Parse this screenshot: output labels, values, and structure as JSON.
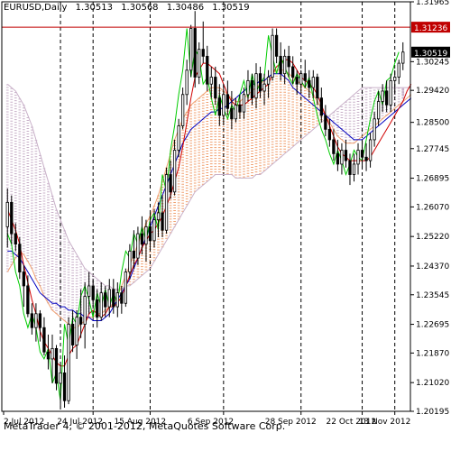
{
  "app": {
    "symbol": "EURUSD",
    "timeframe": "Daily",
    "open": "1.30513",
    "high": "1.30568",
    "low": "1.30486",
    "close": "1.30519",
    "footer": "MetaTrader 4, © 2001-2012, MetaQuotes Software Corp."
  },
  "colors": {
    "background": "#ffffff",
    "candle": "#000000",
    "level_line": "#c00000",
    "level_label_bg": "#c00000",
    "price_label_bg": "#000000",
    "tenkan": "#d00000",
    "kijun": "#0000c0",
    "chikou": "#00cc00",
    "kumo_bull": "#f0a070",
    "kumo_bear": "#c8b0c8"
  },
  "chart_data": {
    "type": "candlestick",
    "title": "EURUSD,Daily",
    "x_tick_labels": [
      "2 Jul 2012",
      "24 Jul 2012",
      "15 Aug 2012",
      "6 Sep 2012",
      "28 Sep 2012",
      "22 Oct 2012",
      "13 Nov 2012"
    ],
    "y_tick_labels": [
      "1.31965",
      "1.31236",
      "1.30519",
      "1.30245",
      "1.29420",
      "1.28500",
      "1.27745",
      "1.26895",
      "1.26070",
      "1.25220",
      "1.24370",
      "1.23545",
      "1.22695",
      "1.21870",
      "1.21020",
      "1.20195"
    ],
    "ylim": [
      1.20195,
      1.31965
    ],
    "level_line": 1.31236,
    "last_price": 1.30519,
    "period_separator_bars": [
      13,
      21,
      35,
      53,
      72,
      87,
      95
    ],
    "ohlc": [
      [
        1.255,
        1.266,
        1.249,
        1.262
      ],
      [
        1.262,
        1.264,
        1.25,
        1.253
      ],
      [
        1.253,
        1.256,
        1.248,
        1.25
      ],
      [
        1.25,
        1.252,
        1.24,
        1.242
      ],
      [
        1.242,
        1.244,
        1.232,
        1.238
      ],
      [
        1.238,
        1.241,
        1.229,
        1.23
      ],
      [
        1.23,
        1.233,
        1.224,
        1.226
      ],
      [
        1.226,
        1.233,
        1.222,
        1.23
      ],
      [
        1.23,
        1.231,
        1.222,
        1.226
      ],
      [
        1.226,
        1.229,
        1.218,
        1.219
      ],
      [
        1.219,
        1.224,
        1.214,
        1.217
      ],
      [
        1.217,
        1.224,
        1.21,
        1.22
      ],
      [
        1.22,
        1.221,
        1.208,
        1.21
      ],
      [
        1.21,
        1.216,
        1.203,
        1.213
      ],
      [
        1.213,
        1.218,
        1.203,
        1.205
      ],
      [
        1.205,
        1.229,
        1.204,
        1.227
      ],
      [
        1.227,
        1.231,
        1.219,
        1.221
      ],
      [
        1.221,
        1.231,
        1.217,
        1.229
      ],
      [
        1.229,
        1.237,
        1.223,
        1.227
      ],
      [
        1.227,
        1.239,
        1.22,
        1.235
      ],
      [
        1.235,
        1.242,
        1.23,
        1.238
      ],
      [
        1.238,
        1.24,
        1.232,
        1.234
      ],
      [
        1.234,
        1.237,
        1.226,
        1.229
      ],
      [
        1.229,
        1.239,
        1.228,
        1.236
      ],
      [
        1.236,
        1.238,
        1.229,
        1.232
      ],
      [
        1.232,
        1.24,
        1.229,
        1.237
      ],
      [
        1.237,
        1.24,
        1.23,
        1.232
      ],
      [
        1.232,
        1.239,
        1.229,
        1.236
      ],
      [
        1.236,
        1.238,
        1.23,
        1.233
      ],
      [
        1.233,
        1.243,
        1.232,
        1.242
      ],
      [
        1.242,
        1.25,
        1.24,
        1.248
      ],
      [
        1.248,
        1.254,
        1.243,
        1.246
      ],
      [
        1.246,
        1.255,
        1.244,
        1.253
      ],
      [
        1.253,
        1.258,
        1.247,
        1.25
      ],
      [
        1.25,
        1.257,
        1.245,
        1.255
      ],
      [
        1.255,
        1.259,
        1.248,
        1.251
      ],
      [
        1.251,
        1.26,
        1.249,
        1.257
      ],
      [
        1.257,
        1.262,
        1.252,
        1.259
      ],
      [
        1.259,
        1.264,
        1.252,
        1.254
      ],
      [
        1.254,
        1.272,
        1.253,
        1.27
      ],
      [
        1.27,
        1.274,
        1.263,
        1.265
      ],
      [
        1.265,
        1.28,
        1.264,
        1.277
      ],
      [
        1.277,
        1.286,
        1.275,
        1.284
      ],
      [
        1.284,
        1.295,
        1.283,
        1.293
      ],
      [
        1.293,
        1.303,
        1.29,
        1.3
      ],
      [
        1.3,
        1.313,
        1.298,
        1.312
      ],
      [
        1.312,
        1.317,
        1.295,
        1.298
      ],
      [
        1.298,
        1.308,
        1.296,
        1.306
      ],
      [
        1.306,
        1.314,
        1.302,
        1.304
      ],
      [
        1.304,
        1.307,
        1.294,
        1.296
      ],
      [
        1.296,
        1.301,
        1.292,
        1.298
      ],
      [
        1.298,
        1.301,
        1.29,
        1.292
      ],
      [
        1.292,
        1.296,
        1.284,
        1.287
      ],
      [
        1.287,
        1.296,
        1.285,
        1.293
      ],
      [
        1.293,
        1.297,
        1.287,
        1.289
      ],
      [
        1.289,
        1.294,
        1.283,
        1.286
      ],
      [
        1.286,
        1.292,
        1.285,
        1.29
      ],
      [
        1.29,
        1.293,
        1.286,
        1.288
      ],
      [
        1.288,
        1.295,
        1.286,
        1.293
      ],
      [
        1.293,
        1.3,
        1.291,
        1.297
      ],
      [
        1.297,
        1.299,
        1.29,
        1.292
      ],
      [
        1.292,
        1.302,
        1.289,
        1.299
      ],
      [
        1.299,
        1.301,
        1.292,
        1.294
      ],
      [
        1.294,
        1.299,
        1.29,
        1.296
      ],
      [
        1.296,
        1.3,
        1.292,
        1.298
      ],
      [
        1.298,
        1.312,
        1.297,
        1.31
      ],
      [
        1.31,
        1.312,
        1.302,
        1.304
      ],
      [
        1.304,
        1.308,
        1.297,
        1.299
      ],
      [
        1.299,
        1.306,
        1.296,
        1.304
      ],
      [
        1.304,
        1.307,
        1.298,
        1.301
      ],
      [
        1.301,
        1.304,
        1.296,
        1.298
      ],
      [
        1.298,
        1.3,
        1.293,
        1.296
      ],
      [
        1.296,
        1.3,
        1.294,
        1.299
      ],
      [
        1.299,
        1.303,
        1.295,
        1.297
      ],
      [
        1.297,
        1.3,
        1.292,
        1.295
      ],
      [
        1.295,
        1.3,
        1.292,
        1.298
      ],
      [
        1.298,
        1.299,
        1.29,
        1.292
      ],
      [
        1.292,
        1.295,
        1.285,
        1.287
      ],
      [
        1.287,
        1.29,
        1.281,
        1.283
      ],
      [
        1.283,
        1.286,
        1.278,
        1.28
      ],
      [
        1.28,
        1.283,
        1.274,
        1.276
      ],
      [
        1.276,
        1.28,
        1.271,
        1.273
      ],
      [
        1.273,
        1.279,
        1.27,
        1.277
      ],
      [
        1.277,
        1.28,
        1.272,
        1.274
      ],
      [
        1.274,
        1.276,
        1.267,
        1.27
      ],
      [
        1.27,
        1.276,
        1.268,
        1.273
      ],
      [
        1.273,
        1.279,
        1.27,
        1.277
      ],
      [
        1.277,
        1.28,
        1.272,
        1.275
      ],
      [
        1.275,
        1.279,
        1.271,
        1.274
      ],
      [
        1.274,
        1.282,
        1.272,
        1.28
      ],
      [
        1.28,
        1.288,
        1.278,
        1.286
      ],
      [
        1.286,
        1.294,
        1.284,
        1.291
      ],
      [
        1.291,
        1.296,
        1.288,
        1.294
      ],
      [
        1.294,
        1.297,
        1.288,
        1.29
      ],
      [
        1.29,
        1.299,
        1.288,
        1.297
      ],
      [
        1.297,
        1.3,
        1.293,
        1.298
      ],
      [
        1.298,
        1.303,
        1.296,
        1.302
      ],
      [
        1.302,
        1.308,
        1.3,
        1.3052
      ]
    ],
    "tenkan_sen": [
      1.26,
      1.257,
      1.254,
      1.25,
      1.244,
      1.239,
      1.234,
      1.23,
      1.225,
      1.222,
      1.22,
      1.218,
      1.216,
      1.215,
      1.215,
      1.218,
      1.22,
      1.221,
      1.224,
      1.227,
      1.23,
      1.231,
      1.23,
      1.229,
      1.23,
      1.232,
      1.232,
      1.233,
      1.235,
      1.238,
      1.241,
      1.244,
      1.246,
      1.249,
      1.251,
      1.253,
      1.254,
      1.256,
      1.258,
      1.261,
      1.264,
      1.268,
      1.272,
      1.278,
      1.285,
      1.292,
      1.298,
      1.3,
      1.302,
      1.302,
      1.301,
      1.3,
      1.299,
      1.296,
      1.293,
      1.291,
      1.29,
      1.29,
      1.29,
      1.291,
      1.292,
      1.293,
      1.294,
      1.295,
      1.296,
      1.299,
      1.301,
      1.302,
      1.303,
      1.303,
      1.302,
      1.3,
      1.298,
      1.297,
      1.296,
      1.295,
      1.293,
      1.29,
      1.287,
      1.284,
      1.281,
      1.278,
      1.276,
      1.275,
      1.274,
      1.274,
      1.274,
      1.274,
      1.274,
      1.275,
      1.277,
      1.279,
      1.281,
      1.283,
      1.285,
      1.287,
      1.289,
      1.291,
      1.294,
      1.296
    ],
    "kijun_sen": [
      1.248,
      1.248,
      1.247,
      1.246,
      1.244,
      1.242,
      1.24,
      1.238,
      1.236,
      1.235,
      1.234,
      1.233,
      1.233,
      1.232,
      1.232,
      1.231,
      1.231,
      1.23,
      1.23,
      1.229,
      1.229,
      1.228,
      1.228,
      1.228,
      1.229,
      1.23,
      1.232,
      1.234,
      1.236,
      1.238,
      1.24,
      1.243,
      1.246,
      1.249,
      1.252,
      1.255,
      1.258,
      1.261,
      1.264,
      1.267,
      1.27,
      1.273,
      1.276,
      1.279,
      1.281,
      1.283,
      1.284,
      1.285,
      1.286,
      1.287,
      1.288,
      1.288,
      1.289,
      1.289,
      1.29,
      1.291,
      1.292,
      1.293,
      1.294,
      1.295,
      1.296,
      1.296,
      1.297,
      1.297,
      1.298,
      1.299,
      1.299,
      1.299,
      1.298,
      1.297,
      1.295,
      1.294,
      1.293,
      1.292,
      1.291,
      1.29,
      1.289,
      1.288,
      1.287,
      1.286,
      1.285,
      1.284,
      1.283,
      1.282,
      1.281,
      1.28,
      1.28,
      1.28,
      1.281,
      1.282,
      1.283,
      1.284,
      1.285,
      1.286,
      1.287,
      1.288,
      1.289,
      1.29,
      1.291,
      1.292
    ],
    "chikou_span": [
      1.253,
      1.25,
      1.242,
      1.238,
      1.23,
      1.226,
      1.23,
      1.226,
      1.219,
      1.217,
      1.22,
      1.21,
      1.213,
      1.205,
      1.227,
      1.221,
      1.229,
      1.227,
      1.235,
      1.238,
      1.234,
      1.229,
      1.236,
      1.232,
      1.237,
      1.232,
      1.236,
      1.233,
      1.242,
      1.248,
      1.246,
      1.253,
      1.25,
      1.255,
      1.251,
      1.257,
      1.259,
      1.254,
      1.27,
      1.265,
      1.277,
      1.284,
      1.293,
      1.3,
      1.312,
      1.298,
      1.306,
      1.304,
      1.296,
      1.298,
      1.292,
      1.287,
      1.293,
      1.289,
      1.286,
      1.29,
      1.288,
      1.293,
      1.297,
      1.292,
      1.299,
      1.294,
      1.296,
      1.298,
      1.31,
      1.304,
      1.299,
      1.304,
      1.301,
      1.298,
      1.296,
      1.299,
      1.297,
      1.295,
      1.298,
      1.292,
      1.287,
      1.283,
      1.28,
      1.276,
      1.273,
      1.277,
      1.274,
      1.27,
      1.273,
      1.277,
      1.275,
      1.274,
      1.28,
      1.286,
      1.291,
      1.294,
      1.29,
      1.297,
      1.298,
      1.302,
      1.3052
    ],
    "senkou_span_a": [
      1.242,
      1.244,
      1.246,
      1.248,
      1.247,
      1.245,
      1.243,
      1.24,
      1.238,
      1.235,
      1.233,
      1.231,
      1.23,
      1.229,
      1.228,
      1.227,
      1.226,
      1.226,
      1.227,
      1.228,
      1.229,
      1.229,
      1.23,
      1.23,
      1.231,
      1.232,
      1.233,
      1.235,
      1.238,
      1.241,
      1.244,
      1.247,
      1.25,
      1.253,
      1.256,
      1.258,
      1.261,
      1.264,
      1.268,
      1.272,
      1.276,
      1.28,
      1.283,
      1.286,
      1.288,
      1.29,
      1.291,
      1.292,
      1.293,
      1.294,
      1.295,
      1.295,
      1.295,
      1.294,
      1.293,
      1.292,
      1.291,
      1.291,
      1.292,
      1.293,
      1.294,
      1.295,
      1.296,
      1.297,
      1.298,
      1.299,
      1.3,
      1.3,
      1.3,
      1.299,
      1.298,
      1.297,
      1.296,
      1.295,
      1.294,
      1.293,
      1.291,
      1.289,
      1.287,
      1.285,
      1.283,
      1.281,
      1.28,
      1.279,
      1.279,
      1.279,
      1.28,
      1.281,
      1.282,
      1.283,
      1.284,
      1.285,
      1.286,
      1.287,
      1.288,
      1.289,
      1.29,
      1.291,
      1.292,
      1.293
    ],
    "senkou_span_b": [
      1.296,
      1.295,
      1.294,
      1.292,
      1.29,
      1.287,
      1.284,
      1.28,
      1.276,
      1.272,
      1.268,
      1.264,
      1.26,
      1.257,
      1.254,
      1.251,
      1.249,
      1.247,
      1.245,
      1.243,
      1.242,
      1.241,
      1.24,
      1.239,
      1.238,
      1.238,
      1.237,
      1.237,
      1.237,
      1.238,
      1.238,
      1.239,
      1.24,
      1.241,
      1.242,
      1.243,
      1.245,
      1.247,
      1.249,
      1.251,
      1.253,
      1.255,
      1.257,
      1.259,
      1.261,
      1.263,
      1.265,
      1.266,
      1.267,
      1.268,
      1.269,
      1.27,
      1.27,
      1.27,
      1.27,
      1.27,
      1.269,
      1.269,
      1.269,
      1.269,
      1.269,
      1.27,
      1.27,
      1.271,
      1.272,
      1.273,
      1.274,
      1.275,
      1.276,
      1.277,
      1.278,
      1.279,
      1.28,
      1.281,
      1.282,
      1.283,
      1.284,
      1.285,
      1.286,
      1.287,
      1.288,
      1.289,
      1.29,
      1.291,
      1.292,
      1.293,
      1.294,
      1.295,
      1.295,
      1.295,
      1.295,
      1.295,
      1.295,
      1.295,
      1.295,
      1.295,
      1.295,
      1.295,
      1.295,
      1.295
    ]
  }
}
